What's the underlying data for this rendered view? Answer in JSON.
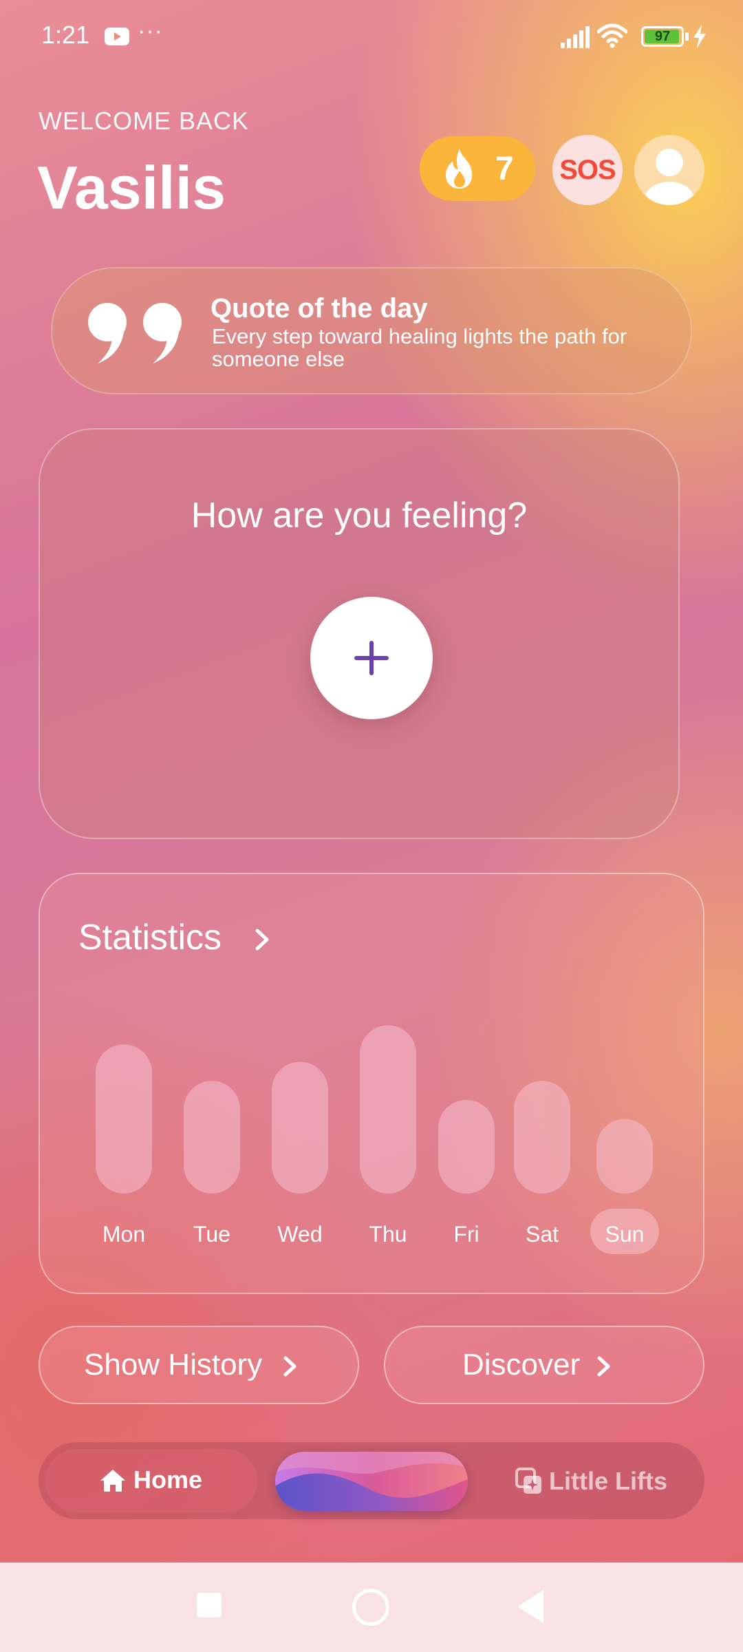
{
  "status_bar": {
    "time": "1:21",
    "more": "···",
    "battery": "97",
    "battery_level": 0.97
  },
  "header": {
    "welcome": "WELCOME BACK",
    "name": "Vasilis",
    "streak": "7",
    "sos_label": "SOS"
  },
  "quote": {
    "title": "Quote of the day",
    "text": "Every step toward healing lights the path for someone else"
  },
  "mood": {
    "title": "How are you feeling?"
  },
  "statistics": {
    "title": "Statistics"
  },
  "chart_data": {
    "type": "bar",
    "categories": [
      "Mon",
      "Tue",
      "Wed",
      "Thu",
      "Fri",
      "Sat",
      "Sun"
    ],
    "values": [
      0.86,
      0.65,
      0.76,
      0.97,
      0.54,
      0.65,
      0.43
    ],
    "highlighted": "Sun"
  },
  "actions": {
    "history": "Show History",
    "discover": "Discover"
  },
  "nav": {
    "home": "Home",
    "lifts": "Little Lifts"
  },
  "colors": {
    "accent": "#6a3fb0",
    "streak": "#fbb53a",
    "sos": "#f24a3a"
  }
}
